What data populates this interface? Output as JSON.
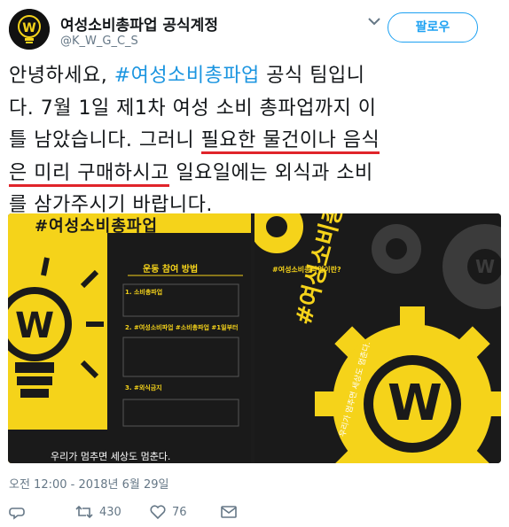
{
  "profile": {
    "name": "여성소비총파업 공식계정",
    "handle": "@K_W_G_C_S",
    "avatar_icon": "lightbulb-logo-icon"
  },
  "header": {
    "follow_label": "팔로우",
    "menu_icon": "chevron-down-icon"
  },
  "tweet": {
    "line1_pre": "안녕하세요, ",
    "line1_hashtag": "#여성소비총파업",
    "line1_post": " 공식 팀입니",
    "line2": "다. 7월 1일 제1차 여성 소비 총파업까지 이",
    "line3_pre": "틀 남았습니다. 그러니 ",
    "line3_underlined": "필요한 물건이나 음식",
    "line4_underlined": "은 미리 구매하시고",
    "line4_post": " 일요일에는 외식과 소비",
    "line5": "를 삼가주시기 바랍니다."
  },
  "media": {
    "left": {
      "banner": "#여성소비총파업",
      "guide_title": "운동 참여 방법",
      "items": [
        "1. 소비총파업",
        "2. #여성소비파업 #소비총파업 #1일부터",
        "3. #외식금지"
      ],
      "slogan": "우리가 멈추면 세상도 멈춘다."
    },
    "right": {
      "question": "#여성소비총파업이란?",
      "vertical_title": "#여성소비총파업",
      "vertical_slogan": "우리가 멈추면 세상도 멈춘다.",
      "badge_letter": "W"
    },
    "colors": {
      "yellow": "#f5d31a",
      "dark": "#1a1a1a",
      "gear_gray": "#3b3b3b"
    }
  },
  "timestamp": "오전 12:00 - 2018년 6월 29일",
  "actions": {
    "reply_icon": "reply-icon",
    "retweet_icon": "retweet-icon",
    "retweet_count": "430",
    "like_icon": "heart-icon",
    "like_count": "76",
    "dm_icon": "envelope-icon"
  }
}
